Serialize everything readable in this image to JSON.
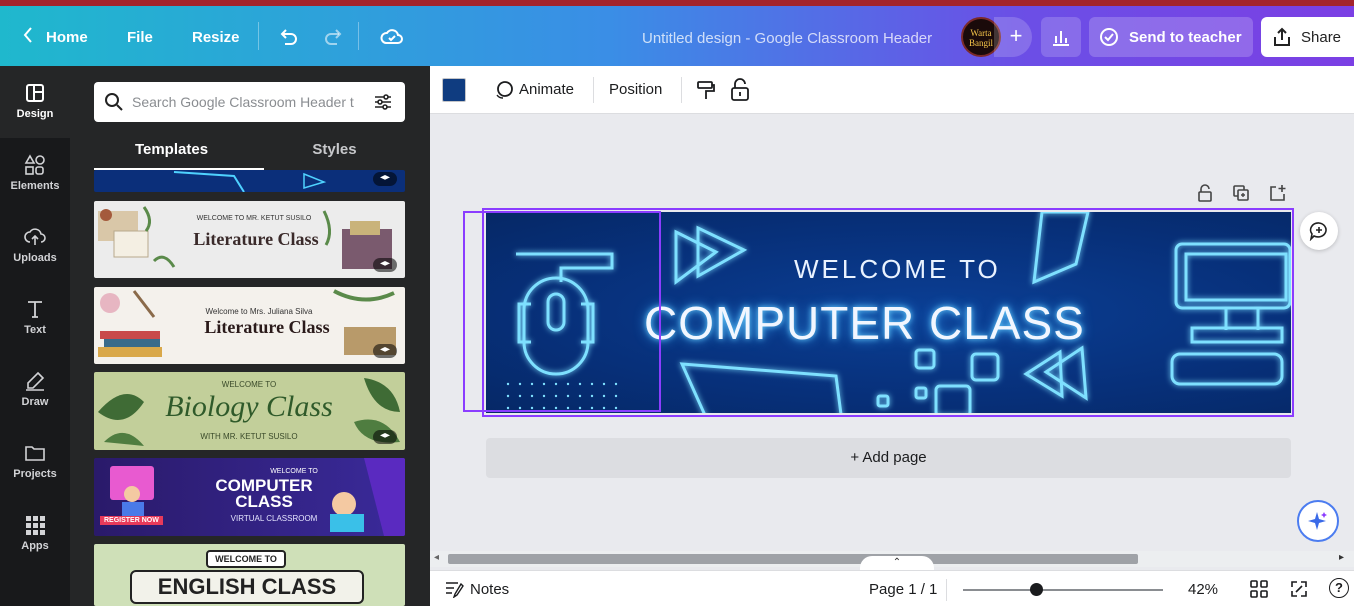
{
  "topbar": {
    "home": "Home",
    "file": "File",
    "resize": "Resize",
    "title": "Untitled design - Google Classroom Header",
    "avatar_text_1": "Warta",
    "avatar_text_2": "Bangil",
    "plus": "+",
    "send_to_teacher": "Send to teacher",
    "share": "Share"
  },
  "rail": {
    "items": [
      {
        "label": "Design",
        "icon": "design-icon"
      },
      {
        "label": "Elements",
        "icon": "elements-icon"
      },
      {
        "label": "Uploads",
        "icon": "uploads-icon"
      },
      {
        "label": "Text",
        "icon": "text-icon"
      },
      {
        "label": "Draw",
        "icon": "draw-icon"
      },
      {
        "label": "Projects",
        "icon": "projects-icon"
      },
      {
        "label": "Apps",
        "icon": "apps-icon"
      }
    ]
  },
  "panel": {
    "search_placeholder": "Search Google Classroom Header t",
    "tabs": [
      "Templates",
      "Styles"
    ],
    "templates": [
      {
        "line1": "WELCOME TO MR. KETUT SUSILO",
        "line2": "Literature Class"
      },
      {
        "line1": "Welcome to Mrs. Juliana Silva",
        "line2": "Literature Class"
      },
      {
        "line1": "WELCOME TO",
        "line2": "Biology Class",
        "line3": "WITH MR. KETUT SUSILO"
      },
      {
        "line1": "WELCOME TO",
        "line2": "COMPUTER",
        "line3": "CLASS",
        "line4": "VIRTUAL CLASSROOM",
        "button": "REGISTER NOW"
      },
      {
        "line1": "WELCOME TO",
        "line2": "ENGLISH CLASS"
      }
    ]
  },
  "toolbar": {
    "color": "#0f3c80",
    "animate": "Animate",
    "position": "Position"
  },
  "canvas": {
    "welcome": "WELCOME TO",
    "title": "COMPUTER CLASS",
    "add_page": "+ Add page"
  },
  "bottombar": {
    "notes": "Notes",
    "page": "Page 1 / 1",
    "zoom": "42%",
    "help": "?"
  },
  "colors": {
    "accent": "#8b3dff",
    "rail_bg": "#18191b",
    "panel_bg": "#252627",
    "design_bg": "#07307a",
    "neon": "#4fd2ff"
  }
}
